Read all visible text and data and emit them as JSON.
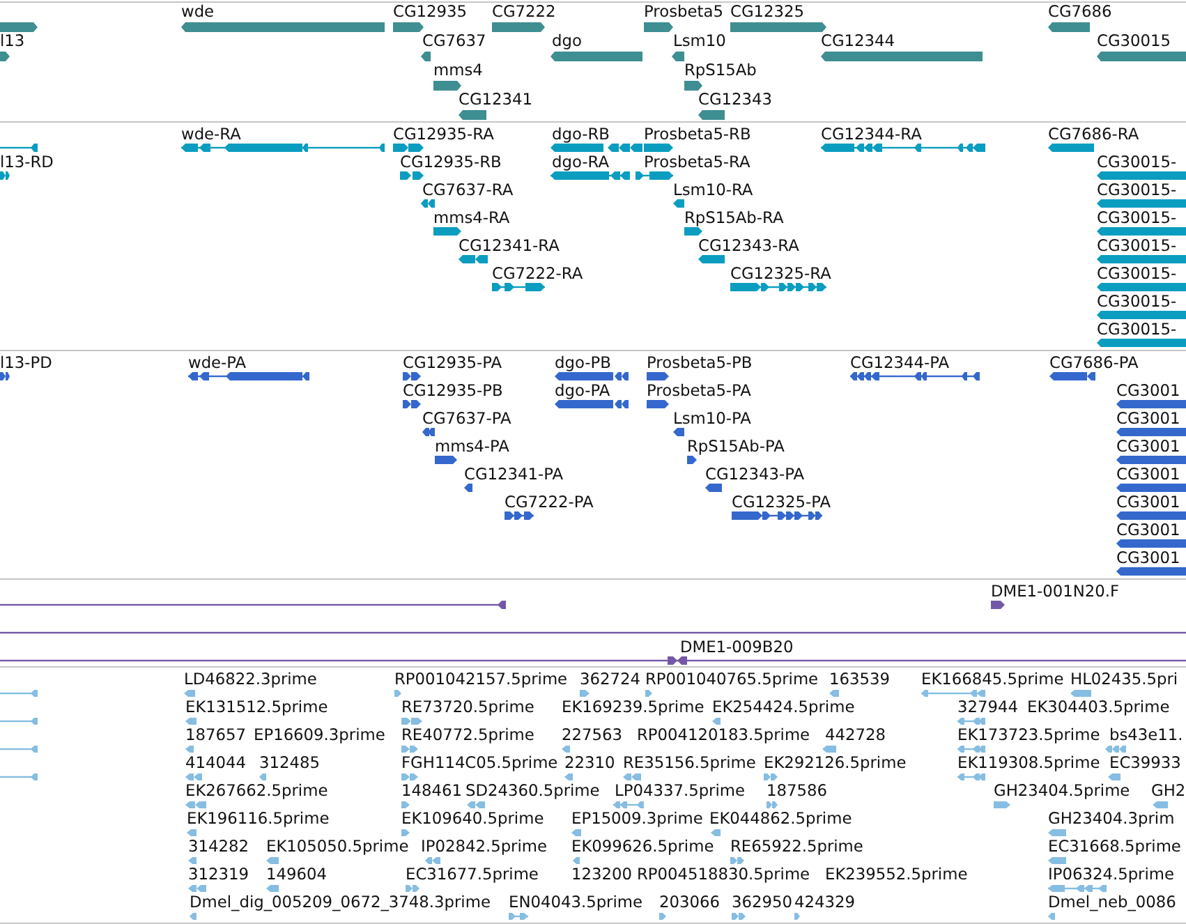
{
  "tracks": [
    {
      "kind": "gene",
      "features": [
        {
          "label": "wde"
        },
        {
          "label": "CG12935"
        },
        {
          "label": "CG7222"
        },
        {
          "label": "Prosbeta5"
        },
        {
          "label": "CG12325"
        },
        {
          "label": "CG7686"
        },
        {
          "label": "l13"
        },
        {
          "label": "CG7637"
        },
        {
          "label": "dgo"
        },
        {
          "label": "Lsm10"
        },
        {
          "label": "CG12344"
        },
        {
          "label": "CG30015"
        },
        {
          "label": "mms4"
        },
        {
          "label": "RpS15Ab"
        },
        {
          "label": "CG12341"
        },
        {
          "label": "CG12343"
        }
      ]
    },
    {
      "kind": "transcript",
      "features": [
        {
          "label": "wde-RA"
        },
        {
          "label": "CG12935-RA"
        },
        {
          "label": "dgo-RB"
        },
        {
          "label": "Prosbeta5-RB"
        },
        {
          "label": "CG12344-RA"
        },
        {
          "label": "CG7686-RA"
        },
        {
          "label": "l13-RD"
        },
        {
          "label": "CG12935-RB"
        },
        {
          "label": "dgo-RA"
        },
        {
          "label": "Prosbeta5-RA"
        },
        {
          "label": "CG30015-"
        },
        {
          "label": "CG7637-RA"
        },
        {
          "label": "Lsm10-RA"
        },
        {
          "label": "CG30015-"
        },
        {
          "label": "mms4-RA"
        },
        {
          "label": "RpS15Ab-RA"
        },
        {
          "label": "CG30015-"
        },
        {
          "label": "CG12341-RA"
        },
        {
          "label": "CG12343-RA"
        },
        {
          "label": "CG30015-"
        },
        {
          "label": "CG7222-RA"
        },
        {
          "label": "CG12325-RA"
        },
        {
          "label": "CG30015-"
        },
        {
          "label": "CG30015-"
        },
        {
          "label": "CG30015-"
        }
      ]
    },
    {
      "kind": "protein",
      "features": [
        {
          "label": "l13-PD"
        },
        {
          "label": "wde-PA"
        },
        {
          "label": "CG12935-PA"
        },
        {
          "label": "dgo-PB"
        },
        {
          "label": "Prosbeta5-PB"
        },
        {
          "label": "CG12344-PA"
        },
        {
          "label": "CG7686-PA"
        },
        {
          "label": "CG12935-PB"
        },
        {
          "label": "dgo-PA"
        },
        {
          "label": "Prosbeta5-PA"
        },
        {
          "label": "CG3001"
        },
        {
          "label": "CG7637-PA"
        },
        {
          "label": "Lsm10-PA"
        },
        {
          "label": "CG3001"
        },
        {
          "label": "mms4-PA"
        },
        {
          "label": "RpS15Ab-PA"
        },
        {
          "label": "CG3001"
        },
        {
          "label": "CG12341-PA"
        },
        {
          "label": "CG12343-PA"
        },
        {
          "label": "CG3001"
        },
        {
          "label": "CG7222-PA"
        },
        {
          "label": "CG12325-PA"
        },
        {
          "label": "CG3001"
        },
        {
          "label": "CG3001"
        },
        {
          "label": "CG3001"
        }
      ]
    },
    {
      "kind": "clone",
      "features": [
        {
          "label": "DME1-001N20.F"
        },
        {
          "label": "DME1-009B20"
        }
      ]
    },
    {
      "kind": "est",
      "features": [
        {
          "label": "LD46822.3prime"
        },
        {
          "label": "RP001042157.5prime"
        },
        {
          "label": "362724"
        },
        {
          "label": "RP001040765.5prime"
        },
        {
          "label": "163539"
        },
        {
          "label": "EK166845.5prime"
        },
        {
          "label": "HL02435.5pri"
        },
        {
          "label": "EK131512.5prime"
        },
        {
          "label": "RE73720.5prime"
        },
        {
          "label": "EK169239.5prime"
        },
        {
          "label": "EK254424.5prime"
        },
        {
          "label": "327944"
        },
        {
          "label": "EK304403.5prime"
        },
        {
          "label": "187657"
        },
        {
          "label": "EP16609.3prime"
        },
        {
          "label": "RE40772.5prime"
        },
        {
          "label": "227563"
        },
        {
          "label": "RP004120183.5prime"
        },
        {
          "label": "442728"
        },
        {
          "label": "EK173723.5prime"
        },
        {
          "label": "bs43e11."
        },
        {
          "label": "414044"
        },
        {
          "label": "312485"
        },
        {
          "label": "FGH114C05.5prime"
        },
        {
          "label": "22310"
        },
        {
          "label": "RE35156.5prime"
        },
        {
          "label": "EK292126.5prime"
        },
        {
          "label": "EK119308.5prime"
        },
        {
          "label": "EC39933"
        },
        {
          "label": "EK267662.5prime"
        },
        {
          "label": "148461"
        },
        {
          "label": "SD24360.5prime"
        },
        {
          "label": "LP04337.5prime"
        },
        {
          "label": "187586"
        },
        {
          "label": "GH23404.5prime"
        },
        {
          "label": "GH2"
        },
        {
          "label": "EK196116.5prime"
        },
        {
          "label": "EK109640.5prime"
        },
        {
          "label": "EP15009.3prime"
        },
        {
          "label": "EK044862.5prime"
        },
        {
          "label": "GH23404.3prim"
        },
        {
          "label": "314282"
        },
        {
          "label": "EK105050.5prime"
        },
        {
          "label": "IP02842.5prime"
        },
        {
          "label": "EK099626.5prime"
        },
        {
          "label": "RE65922.5prime"
        },
        {
          "label": "EC31668.5prime"
        },
        {
          "label": "312319"
        },
        {
          "label": "149604"
        },
        {
          "label": "EC31677.5prime"
        },
        {
          "label": "123200"
        },
        {
          "label": "RP004518830.5prime"
        },
        {
          "label": "EK239552.5prime"
        },
        {
          "label": "IP06324.5prime"
        },
        {
          "label": "Dmel_dig_005209_0672_3748.3prime"
        },
        {
          "label": "EN04043.5prime"
        },
        {
          "label": "203066"
        },
        {
          "label": "362950"
        },
        {
          "label": "424329"
        },
        {
          "label": "Dmel_neb_0086"
        }
      ]
    }
  ]
}
